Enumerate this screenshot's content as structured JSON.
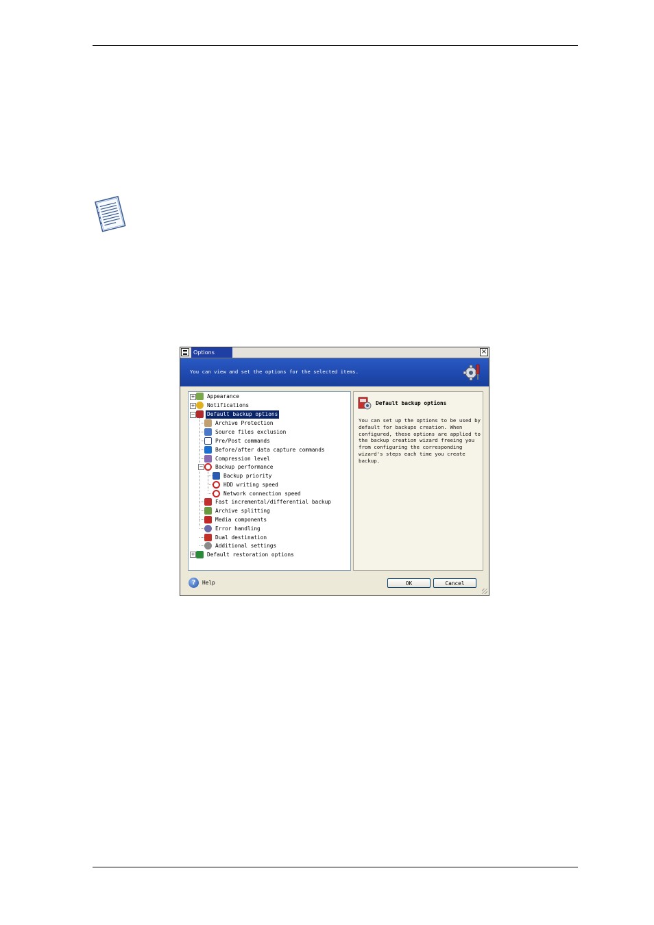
{
  "dialog": {
    "title": "Options",
    "close_glyph": "×",
    "banner_text": "You can view and set the options for the selected items.",
    "tree": [
      {
        "label": "Appearance",
        "icon": "appearance-icon",
        "color": "#7aa84a",
        "expander": "+"
      },
      {
        "label": "Notifications",
        "icon": "notifications-icon",
        "color": "#e0b020",
        "expander": "+"
      },
      {
        "label": "Default backup options",
        "icon": "backup-options-icon",
        "color": "#b0282c",
        "expander": "−",
        "selected": true
      },
      {
        "label": "Archive Protection",
        "icon": "archive-protection-icon",
        "color": "#c0a070"
      },
      {
        "label": "Source files exclusion",
        "icon": "source-files-exclusion-icon",
        "color": "#4a78c8"
      },
      {
        "label": "Pre/Post commands",
        "icon": "pre-post-commands-icon",
        "color": "#ffffff"
      },
      {
        "label": "Before/after data capture commands",
        "icon": "data-capture-commands-icon",
        "color": "#1a6fd0"
      },
      {
        "label": "Compression level",
        "icon": "compression-level-icon",
        "color": "#8a6ab0"
      },
      {
        "label": "Backup performance",
        "icon": "backup-performance-icon",
        "color": "#d02020",
        "expander": "−"
      },
      {
        "label": "Backup priority",
        "icon": "backup-priority-icon",
        "color": "#2a5ab0"
      },
      {
        "label": "HDD writing speed",
        "icon": "hdd-writing-speed-icon",
        "color": "#d02020"
      },
      {
        "label": "Network connection speed",
        "icon": "network-connection-speed-icon",
        "color": "#d02020"
      },
      {
        "label": "Fast incremental/differential backup",
        "icon": "fast-incremental-icon",
        "color": "#c03030"
      },
      {
        "label": "Archive splitting",
        "icon": "archive-splitting-icon",
        "color": "#6a9a40"
      },
      {
        "label": "Media components",
        "icon": "media-components-icon",
        "color": "#c02828"
      },
      {
        "label": "Error handling",
        "icon": "error-handling-icon",
        "color": "#6a6aa8"
      },
      {
        "label": "Dual destination",
        "icon": "dual-destination-icon",
        "color": "#c03028"
      },
      {
        "label": "Additional settings",
        "icon": "additional-settings-icon",
        "color": "#8a8a8a"
      },
      {
        "label": "Default restoration options",
        "icon": "restoration-options-icon",
        "color": "#2a8a3a",
        "expander": "+"
      }
    ],
    "description": {
      "title": "Default backup options",
      "text": "You can set up the options to be used by default for backups creation. When configured, these options are applied to the backup creation wizard freeing you from configuring the corresponding wizard's steps each time you create backup."
    },
    "buttons": {
      "help": "Help",
      "ok": "OK",
      "cancel": "Cancel"
    }
  },
  "colors": {
    "banner": "#1e48ad",
    "selection": "#0a246a",
    "dialog_face": "#ece9d8"
  }
}
